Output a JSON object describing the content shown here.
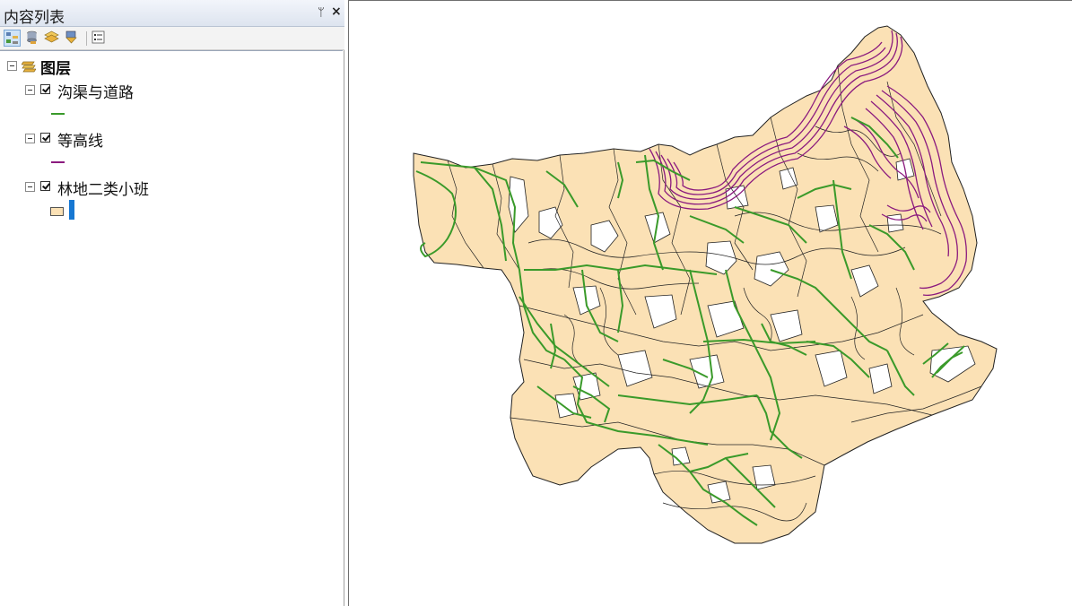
{
  "toc": {
    "title": "内容列表",
    "pin_symbol": "ᛘ",
    "close_symbol": "×",
    "toolbar": [
      {
        "name": "list-by-drawing-order-icon",
        "active": true
      },
      {
        "name": "list-by-source-icon",
        "active": false
      },
      {
        "name": "list-by-visibility-icon",
        "active": false
      },
      {
        "name": "list-by-selection-icon",
        "active": false
      },
      {
        "name": "options-icon",
        "active": false
      }
    ],
    "root": {
      "label": "图层"
    },
    "layers": [
      {
        "label": "沟渠与道路",
        "checked": true,
        "symbol": "line",
        "color": "#3a9a2a"
      },
      {
        "label": "等高线",
        "checked": true,
        "symbol": "line",
        "color": "#8b1a7e"
      },
      {
        "label": "林地二类小班",
        "checked": true,
        "symbol": "polygon",
        "color": "#fbe1b5",
        "outline": "#555555"
      }
    ]
  },
  "map": {
    "colors": {
      "polygon_fill": "#fbe1b5",
      "polygon_edge": "#222222",
      "contour": "#8b1a7e",
      "road": "#3a9a2a"
    }
  }
}
